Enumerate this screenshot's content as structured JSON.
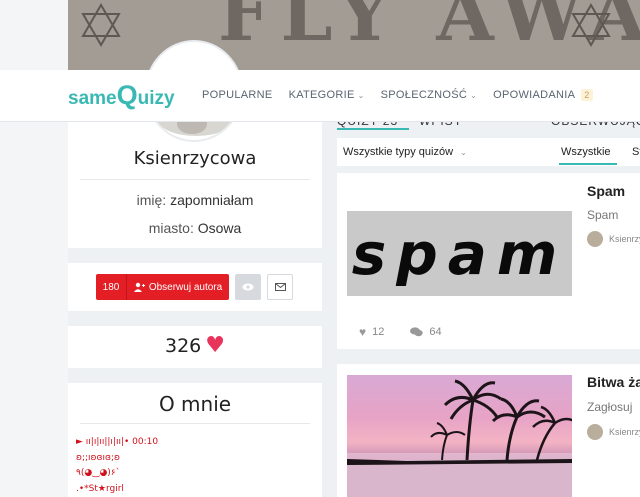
{
  "banner": {
    "text": "FLY AWAY"
  },
  "brand": {
    "logo_part1": "same",
    "logo_part2": "Q",
    "logo_part3": "uizy"
  },
  "nav": {
    "items": [
      {
        "label": "POPULARNE",
        "has_chevron": false
      },
      {
        "label": "KATEGORIE",
        "has_chevron": true
      },
      {
        "label": "SPOŁECZNOŚĆ",
        "has_chevron": true
      },
      {
        "label": "OPOWIADANIA",
        "has_chevron": false,
        "badge": "2"
      }
    ]
  },
  "profile": {
    "username": "Ksienrzycowa",
    "name_label": "imię:",
    "name_value": "zapomniałam",
    "city_label": "miasto:",
    "city_value": "Osowa"
  },
  "actions": {
    "follow_count": "180",
    "follow_label": "Obserwuj autora"
  },
  "likes": {
    "count": "326"
  },
  "about": {
    "title": "O mnie",
    "lines": [
      "► ıı|ı|ıı||ı|ıı|• 00:10",
      "ʚ;;ıʚɞıɞ;ʚ",
      "٩(◕‿◕)۶`",
      ".•*St★rgirl"
    ]
  },
  "content_tabs": {
    "tab1": "QUIZY 23",
    "tab2": "WPISY",
    "tab3": "OBSERWUJĄCY"
  },
  "filter": {
    "dropdown": "Wszystkie typy quizów",
    "tab_all": "Wszystkie",
    "tab_other": "St"
  },
  "quizzes": [
    {
      "title": "Spam",
      "description": "Spam",
      "author": "Ksienrzy",
      "image_text": "spam",
      "likes": "12",
      "comments": "64"
    },
    {
      "title": "Bitwa ża",
      "description": "Zagłosuj",
      "author": "Ksienrzy"
    }
  ],
  "colors": {
    "accent": "#3ab9b4",
    "red": "#e31e24",
    "heart": "#e8335a"
  }
}
